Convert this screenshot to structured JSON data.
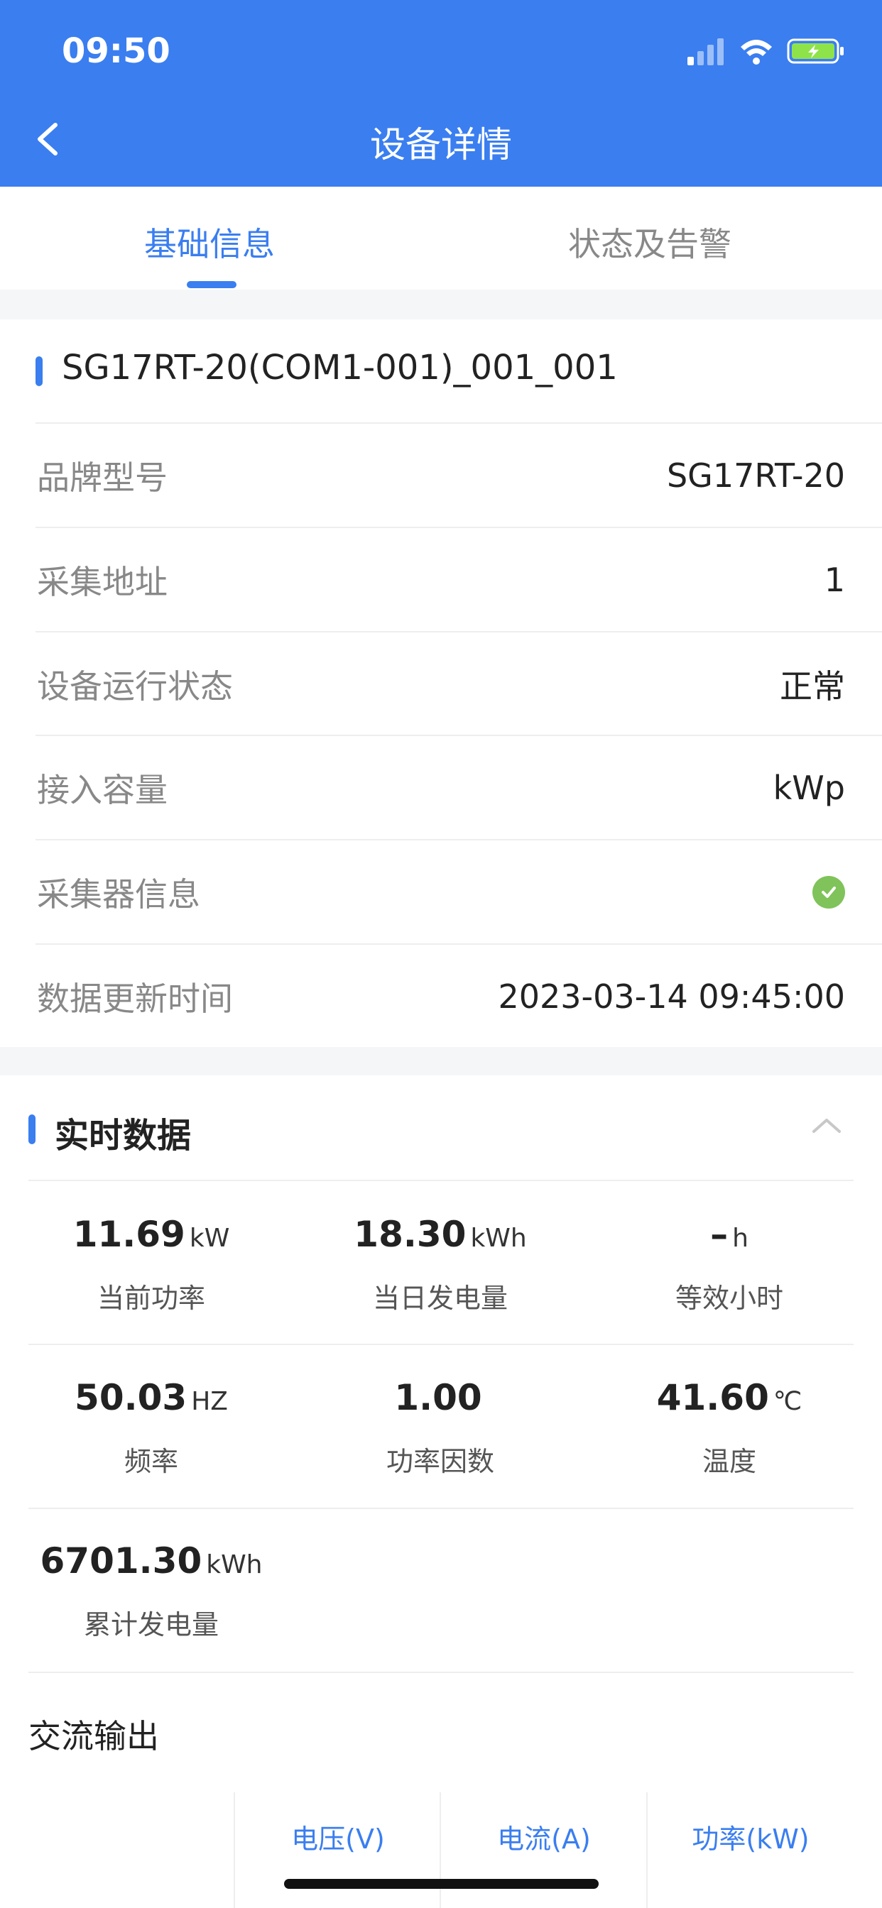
{
  "status_bar": {
    "time": "09:50"
  },
  "nav": {
    "title": "设备详情"
  },
  "tabs": [
    {
      "label": "基础信息",
      "active": true
    },
    {
      "label": "状态及告警",
      "active": false
    }
  ],
  "device": {
    "name": "SG17RT-20(COM1-001)_001_001",
    "rows": [
      {
        "label": "品牌型号",
        "value": "SG17RT-20"
      },
      {
        "label": "采集地址",
        "value": "1"
      },
      {
        "label": "设备运行状态",
        "value": "正常"
      },
      {
        "label": "接入容量",
        "value": "kWp"
      },
      {
        "label": "采集器信息",
        "value": ""
      },
      {
        "label": "数据更新时间",
        "value": "2023-03-14 09:45:00"
      }
    ]
  },
  "realtime": {
    "title": "实时数据",
    "metrics": [
      {
        "value": "11.69",
        "unit": "kW",
        "caption": "当前功率"
      },
      {
        "value": "18.30",
        "unit": "kWh",
        "caption": "当日发电量"
      },
      {
        "value": "–",
        "unit": "h",
        "caption": "等效小时"
      },
      {
        "value": "50.03",
        "unit": "HZ",
        "caption": "频率"
      },
      {
        "value": "1.00",
        "unit": "",
        "caption": "功率因数"
      },
      {
        "value": "41.60",
        "unit": "℃",
        "caption": "温度"
      },
      {
        "value": "6701.30",
        "unit": "kWh",
        "caption": "累计发电量"
      }
    ]
  },
  "ac_output": {
    "title": "交流输出",
    "headers": [
      "电压(V)",
      "电流(A)",
      "功率(kW)"
    ]
  },
  "colors": {
    "primary": "#3a7ef0",
    "success": "#7fc35a"
  }
}
